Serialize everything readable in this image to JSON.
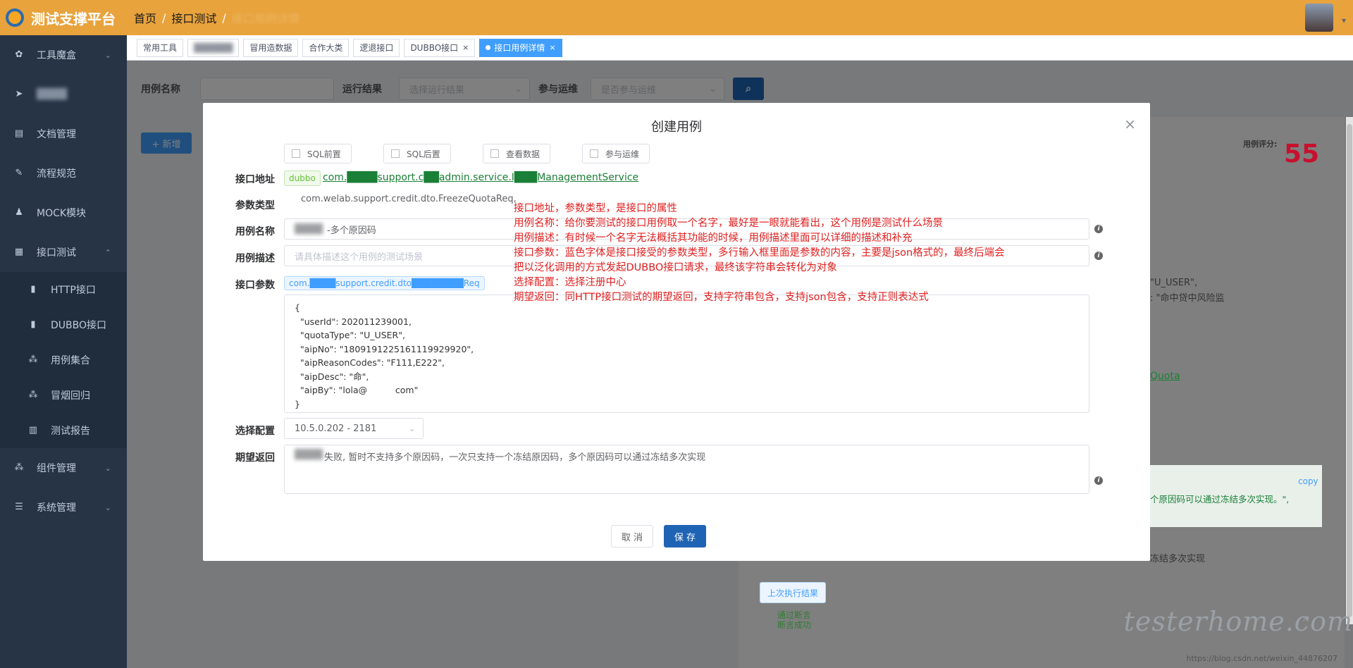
{
  "app": {
    "title": "测试支撑平台"
  },
  "breadcrumb": {
    "home": "首页",
    "section": "接口测试",
    "current": "接口用例详情"
  },
  "sidebar": {
    "items": [
      {
        "label": "工具魔盒",
        "icon": "gear-icon"
      },
      {
        "label": "",
        "icon": "send-icon"
      },
      {
        "label": "文档管理",
        "icon": "document-icon"
      },
      {
        "label": "流程规范",
        "icon": "edit-icon"
      },
      {
        "label": "MOCK模块",
        "icon": "user-icon"
      },
      {
        "label": "接口测试",
        "icon": "grid-icon"
      }
    ],
    "sub_items": [
      {
        "label": "HTTP接口"
      },
      {
        "label": "DUBBO接口"
      },
      {
        "label": "用例集合"
      },
      {
        "label": "冒烟回归"
      },
      {
        "label": "测试报告"
      }
    ],
    "bottom_items": [
      {
        "label": "组件管理"
      },
      {
        "label": "系统管理"
      }
    ]
  },
  "tabs": [
    "常用工具",
    "",
    "冒用造数据",
    "合作大类",
    "逻退接口",
    "DUBBO接口",
    "接口用例详情"
  ],
  "search": {
    "case_name_label": "用例名称",
    "run_result_label": "运行结果",
    "run_result_placeholder": "选择运行结果",
    "ops_label": "参与运维",
    "ops_placeholder": "是否参与运维"
  },
  "background": {
    "new_button": "+ 新增",
    "score_label": "用例评分:",
    "score_value": "55",
    "right_text_1": "\"U_USER\",",
    "right_text_2": ": \"命中贷中风险监",
    "right_link": "Quota",
    "copy": "copy",
    "right_text_3": "个原因码可以通过冻结多次实现。\",",
    "right_text_4": "冻结多次实现",
    "last_result_button": "上次执行结果",
    "pass_assert": "通过断言",
    "assert_ok": "断言成功"
  },
  "modal": {
    "title": "创建用例",
    "checkboxes": [
      "SQL前置",
      "SQL后置",
      "查看数据",
      "参与运维"
    ],
    "labels": {
      "address": "接口地址",
      "param_type": "参数类型",
      "case_name": "用例名称",
      "case_desc": "用例描述",
      "params": "接口参数",
      "config": "选择配置",
      "expected": "期望返回"
    },
    "address_tag": "dubbo",
    "address_link": "com.████support.c██admin.service.I███ManagementService",
    "param_type_value": "com.welab.support.credit.dto.FreezeQuotaReq,",
    "case_name_value": "-多个原因码",
    "case_desc_placeholder": "请具体描述这个用例的测试场景",
    "param_tag": "com.████support.credit.dto████████Req",
    "params_code": "{\n  \"userId\": 202011239001,\n  \"quotaType\": \"U_USER\",\n  \"aipNo\": \"180919122516111992992​0\",\n  \"aipReasonCodes\": \"F111,E222\",\n  \"aipDesc\": \"命\",\n  \"aipBy\": \"lola@          com\"\n}",
    "config_value": "10.5.0.202 - 2181",
    "expected_value": "失败, 暂时不支持多个原因码，一次只支持一个冻结原因码，多个原因码可以通过冻结多次实现",
    "cancel": "取 消",
    "save": "保 存",
    "annotation": "接口地址，参数类型，是接口的属性\n用例名称：给你要测试的接口用例取一个名字，最好是一眼就能看出，这个用例是测试什么场景\n用例描述：有时候一个名字无法概括其功能的时候，用例描述里面可以详细的描述和补充\n接口参数：蓝色字体是接口接受的参数类型，多行输入框里面是参数的内容，主要是json格式的，最终后端会\n把以泛化调用的方式发起DUBBO接口请求，最终该字符串会转化为对象\n选择配置：选择注册中心\n期望返回：同HTTP接口测试的期望返回，支持字符串包含，支持json包含，支持正则表达式"
  },
  "watermark": "testerhome.com",
  "url": "https://blog.csdn.net/weixin_44876207",
  "colors": {
    "topbar": "#e8a33d",
    "sidebar": "#263445",
    "primary": "#1f64b4",
    "annotation": "#e02020",
    "score": "#c8102e"
  }
}
